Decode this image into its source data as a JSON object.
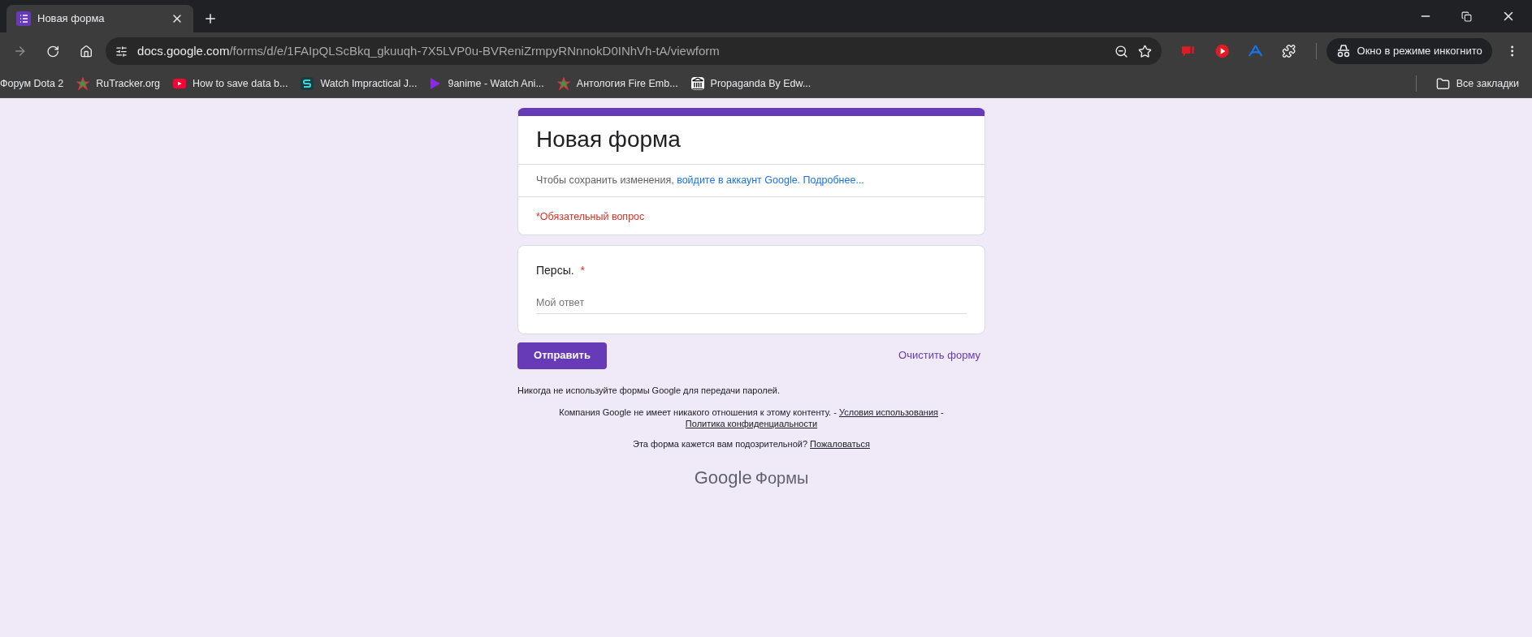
{
  "browser": {
    "tab": {
      "title": "Новая форма",
      "selected": true
    },
    "url_host": "docs.google.com",
    "url_path": "/forms/d/e/1FAIpQLScBkq_gkuuqh-7X5LVP0u-BVReniZrmpyRNnnokD0INhVh-tA/viewform",
    "incognito_label": "Окно в режиме инкогнито",
    "bookmarks": [
      {
        "label": "Форум Dota 2",
        "kind": "none"
      },
      {
        "label": "RuTracker.org",
        "kind": "star"
      },
      {
        "label": "How to save data b...",
        "kind": "video"
      },
      {
        "label": "Watch Impractical J...",
        "kind": "letter"
      },
      {
        "label": "9anime - Watch Ani...",
        "kind": "play"
      },
      {
        "label": "Антология Fire Emb...",
        "kind": "star"
      },
      {
        "label": "Propaganda By Edw...",
        "kind": "building"
      }
    ],
    "all_bookmarks": "Все закладки"
  },
  "form": {
    "title": "Новая форма",
    "notice": "Чтобы сохранить изменения, ",
    "sign_in_link": "войдите в аккаунт Google.",
    "learn_more_link": "Подробнее...",
    "required_note": "*Обязательный вопрос",
    "questions": [
      {
        "label": "Персы.",
        "required": true,
        "required_mark": "*",
        "placeholder": "Мой ответ"
      }
    ],
    "submit": "Отправить",
    "clear": "Очистить форму"
  },
  "footer": {
    "password_warning": "Никогда не используйте формы Google для передачи паролей.",
    "disclaimer": "Компания Google не имеет никакого отношения к этому контенту. - ",
    "terms_link": "Условия использования",
    "separator": " - ",
    "privacy_link": "Политика конфиденциальности",
    "suspicious": "Эта форма кажется вам подозрительной? ",
    "report_link": "Пожаловаться"
  },
  "logo": {
    "brand": "Google",
    "product": "Формы"
  }
}
